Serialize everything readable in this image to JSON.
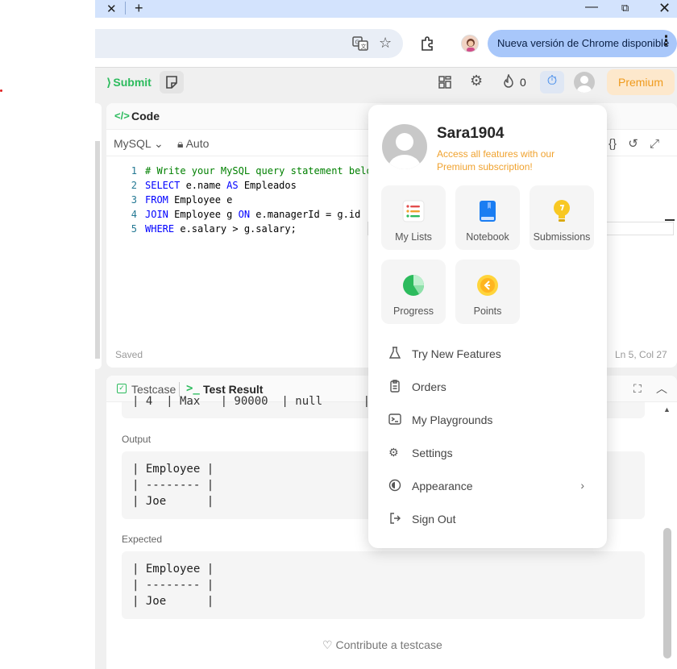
{
  "browser": {
    "update_banner": "Nueva versión de Chrome disponible",
    "tab_close": "✕",
    "new_tab": "+",
    "window_minimize": "—",
    "window_maximize": "⧉",
    "window_close": "✕",
    "menu_dots": "⋮"
  },
  "header": {
    "submit_label": "Submit",
    "streak_count": "0",
    "premium_label": "Premium"
  },
  "code_panel": {
    "tab_label": "Code",
    "language": "MySQL",
    "mode": "Auto",
    "lines": [
      {
        "num": "1",
        "text": "# Write your MySQL query statement belo"
      },
      {
        "num": "2",
        "kw1": "SELECT",
        "t1": " e.name ",
        "kw2": "AS",
        "t2": " Empleados"
      },
      {
        "num": "3",
        "kw1": "FROM",
        "t1": " Employee e"
      },
      {
        "num": "4",
        "kw1": "JOIN",
        "t1": " Employee g ",
        "kw2": "ON",
        "t2": " e.managerId = g.id"
      },
      {
        "num": "5",
        "kw1": "WHERE",
        "t1": " e.salary > g.salary;"
      }
    ],
    "status_saved": "Saved",
    "cursor_position": "Ln 5, Col 27"
  },
  "test_panel": {
    "testcase_tab": "Testcase",
    "result_tab": "Test Result",
    "prev_row": "| 4  | Max   | 90000  | null      |",
    "output_label": "Output",
    "output_text": "| Employee |\n| -------- |\n| Joe      |",
    "expected_label": "Expected",
    "expected_text": "| Employee |\n| -------- |\n| Joe      |",
    "contribute_label": "Contribute a testcase"
  },
  "user_menu": {
    "username": "Sara1904",
    "premium_note": "Access all features with our Premium subscription!",
    "tiles": [
      {
        "label": "My Lists",
        "icon": "list-icon"
      },
      {
        "label": "Notebook",
        "icon": "notebook-icon"
      },
      {
        "label": "Submissions",
        "icon": "lightbulb-icon"
      },
      {
        "label": "Progress",
        "icon": "progress-icon"
      },
      {
        "label": "Points",
        "icon": "points-icon"
      }
    ],
    "items": [
      {
        "label": "Try New Features",
        "icon": "flask-icon"
      },
      {
        "label": "Orders",
        "icon": "orders-icon"
      },
      {
        "label": "My Playgrounds",
        "icon": "playground-icon"
      },
      {
        "label": "Settings",
        "icon": "gear-icon"
      },
      {
        "label": "Appearance",
        "icon": "appearance-icon"
      },
      {
        "label": "Sign Out",
        "icon": "sign-out-icon"
      }
    ]
  },
  "colors": {
    "accent_green": "#2cbb5d",
    "premium_orange": "#f0a22e",
    "chrome_blue": "#d3e3fd"
  }
}
